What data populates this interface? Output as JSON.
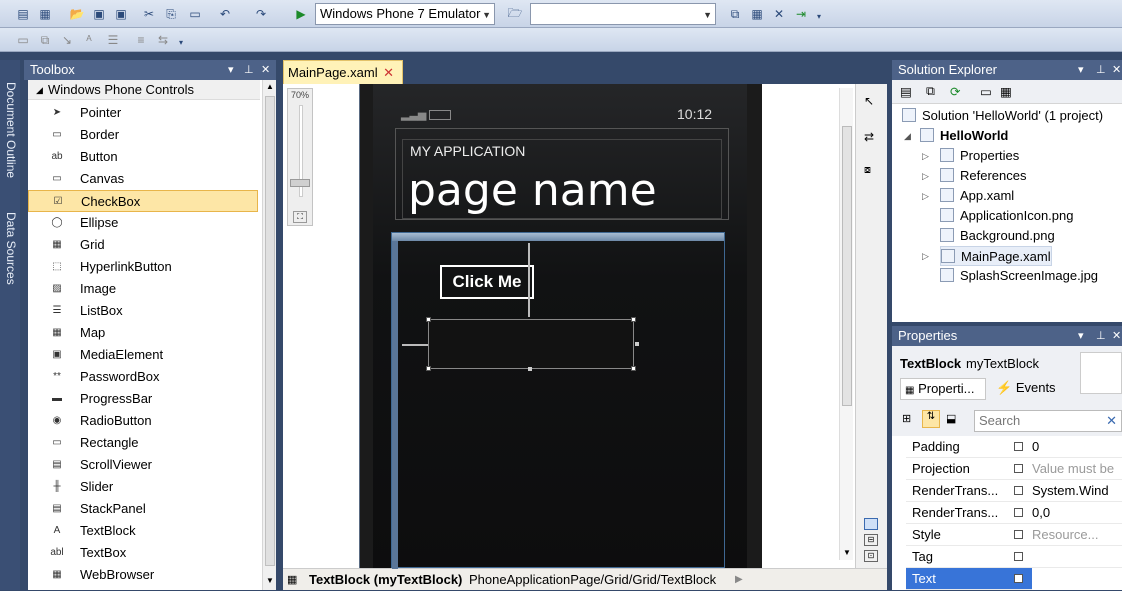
{
  "toolbar": {
    "target_device": "Windows Phone 7 Emulator",
    "solution_config": ""
  },
  "sidebar": {
    "tabs": [
      "Document Outline",
      "Data Sources"
    ]
  },
  "toolbox": {
    "title": "Toolbox",
    "category": "Windows Phone Controls",
    "items": [
      {
        "label": "Pointer",
        "icon": "pointer-icon"
      },
      {
        "label": "Border",
        "icon": "border-icon"
      },
      {
        "label": "Button",
        "icon": "button-icon"
      },
      {
        "label": "Canvas",
        "icon": "canvas-icon"
      },
      {
        "label": "CheckBox",
        "icon": "checkbox-icon",
        "selected": true
      },
      {
        "label": "Ellipse",
        "icon": "ellipse-icon"
      },
      {
        "label": "Grid",
        "icon": "grid-icon"
      },
      {
        "label": "HyperlinkButton",
        "icon": "hyperlink-icon"
      },
      {
        "label": "Image",
        "icon": "image-icon"
      },
      {
        "label": "ListBox",
        "icon": "listbox-icon"
      },
      {
        "label": "Map",
        "icon": "map-icon"
      },
      {
        "label": "MediaElement",
        "icon": "media-icon"
      },
      {
        "label": "PasswordBox",
        "icon": "password-icon"
      },
      {
        "label": "ProgressBar",
        "icon": "progressbar-icon"
      },
      {
        "label": "RadioButton",
        "icon": "radio-icon"
      },
      {
        "label": "Rectangle",
        "icon": "rectangle-icon"
      },
      {
        "label": "ScrollViewer",
        "icon": "scrollviewer-icon"
      },
      {
        "label": "Slider",
        "icon": "slider-icon"
      },
      {
        "label": "StackPanel",
        "icon": "stackpanel-icon"
      },
      {
        "label": "TextBlock",
        "icon": "textblock-icon"
      },
      {
        "label": "TextBox",
        "icon": "textbox-icon"
      },
      {
        "label": "WebBrowser",
        "icon": "webbrowser-icon"
      }
    ]
  },
  "document": {
    "tab": "MainPage.xaml",
    "zoom": "70%",
    "phone": {
      "time": "10:12",
      "app_title": "MY APPLICATION",
      "page_title": "page name",
      "button_label": "Click Me"
    },
    "status": {
      "element": "TextBlock (myTextBlock)",
      "path": "PhoneApplicationPage/Grid/Grid/TextBlock"
    }
  },
  "solution_explorer": {
    "title": "Solution Explorer",
    "solution": "Solution 'HelloWorld' (1 project)",
    "project": "HelloWorld",
    "items": [
      "Properties",
      "References",
      "App.xaml",
      "ApplicationIcon.png",
      "Background.png",
      "MainPage.xaml",
      "SplashScreenImage.jpg"
    ]
  },
  "properties": {
    "title": "Properties",
    "element_type": "TextBlock",
    "element_name": "myTextBlock",
    "tab_properties": "Properti...",
    "tab_events": "Events",
    "search_placeholder": "Search",
    "rows": [
      {
        "name": "Padding",
        "value": "0"
      },
      {
        "name": "Projection",
        "value": "Value must be"
      },
      {
        "name": "RenderTrans...",
        "value": "System.Wind"
      },
      {
        "name": "RenderTrans...",
        "value": "0,0"
      },
      {
        "name": "Style",
        "value": "Resource..."
      },
      {
        "name": "Tag",
        "value": ""
      },
      {
        "name": "Text",
        "value": ""
      }
    ]
  }
}
